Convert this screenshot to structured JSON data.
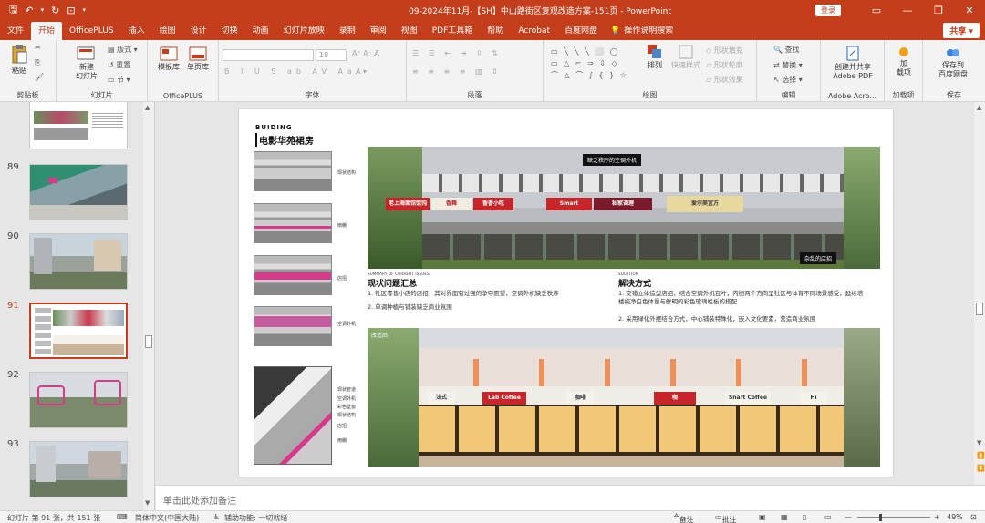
{
  "app": {
    "title": "09-2024年11月-【SH】中山路街区复观改造方案-151页 - PowerPoint",
    "login": "登录",
    "share": "共享"
  },
  "tabs": [
    "文件",
    "开始",
    "OfficePLUS",
    "插入",
    "绘图",
    "设计",
    "切换",
    "动画",
    "幻灯片放映",
    "录制",
    "审阅",
    "视图",
    "PDF工具箱",
    "帮助",
    "Acrobat",
    "百度网盘"
  ],
  "active_tab": "开始",
  "tell_me": "操作说明搜索",
  "ribbon": {
    "clipboard": {
      "paste": "粘贴",
      "label": "剪贴板"
    },
    "slides": {
      "new_slide": "新建\n幻灯片",
      "layout": "版式",
      "reset": "重置",
      "section": "节",
      "label": "幻灯片"
    },
    "officeplus": {
      "template": "模板库",
      "single": "单页库",
      "label": "OfficePLUS"
    },
    "font": {
      "size": "18",
      "label": "字体"
    },
    "paragraph": {
      "label": "段落"
    },
    "drawing": {
      "arrange": "排列",
      "quick_styles": "快速样式",
      "fill": "形状填充",
      "outline": "形状轮廓",
      "effects": "形状效果",
      "label": "绘图"
    },
    "editing": {
      "find": "查找",
      "replace": "替换",
      "select": "选择",
      "label": "编辑"
    },
    "adobe": {
      "create": "创建并共享\nAdobe PDF",
      "label": "Adobe Acro..."
    },
    "addins": {
      "addin": "加\n载项",
      "label": "加载项"
    },
    "save": {
      "save_baidu": "保存到\n百度网盘",
      "label": "保存"
    }
  },
  "thumbnails": [
    {
      "num": "89",
      "active": false
    },
    {
      "num": "90",
      "active": false
    },
    {
      "num": "91",
      "active": true
    },
    {
      "num": "92",
      "active": false
    },
    {
      "num": "93",
      "active": false
    }
  ],
  "slide": {
    "eyebrow": "BUIDING",
    "heading": "电影华苑裙房",
    "facade_labels": [
      "现状结构",
      "雨棚",
      "店招",
      "空调外机"
    ],
    "axon_labels": [
      "现状管道",
      "空调外机",
      "彩色壁窗",
      "现状结构",
      "店招",
      "雨棚"
    ],
    "callout_top": "缺乏秩序的空调外机",
    "callout_bottom": "杂乱的店招",
    "summary_small": "SUMMARY OF CURRENT ISSUES",
    "summary_head": "现状问题汇总",
    "summary_1": "1. 社区零售小店的店招，其对界面有过强的争夺愿望，空调外机缺乏秩序",
    "summary_2": "2. 单调种植与铺装缺乏商业氛围",
    "solution_small": "SOLUTION",
    "solution_head": "解决方式",
    "solution_1": "1. 交错立体造型店招，结合空调外机百叶，内街两个方向呈社区与体育不同场景感受，延续塔楼纯净白色体量与鲜明的彩色玻璃栏板的搭配",
    "solution_2": "2. 采用绿化外摆结合方式，中心铺装特殊化，嵌入文化要素，营造商业氛围",
    "before_signs": [
      "老上海面馆馄饨",
      "香舞",
      "香香小吃",
      "Smart",
      "私家调理",
      "爱尔美宜方"
    ],
    "after_label": "改造后",
    "after_signs": [
      "法式",
      "Lab Coffee",
      "咖啡",
      "咖",
      "Snart Coffee",
      "Hi"
    ]
  },
  "notes_placeholder": "单击此处添加备注",
  "status": {
    "slide_info": "幻灯片 第 91 张，共 151 张",
    "language": "简体中文(中国大陆)",
    "accessibility": "辅助功能: 一切就绪",
    "notes_btn": "备注",
    "comments_btn": "批注",
    "zoom": "49%"
  },
  "colors": {
    "brand": "#c43e1c",
    "accent_pink": "#d8398a"
  }
}
